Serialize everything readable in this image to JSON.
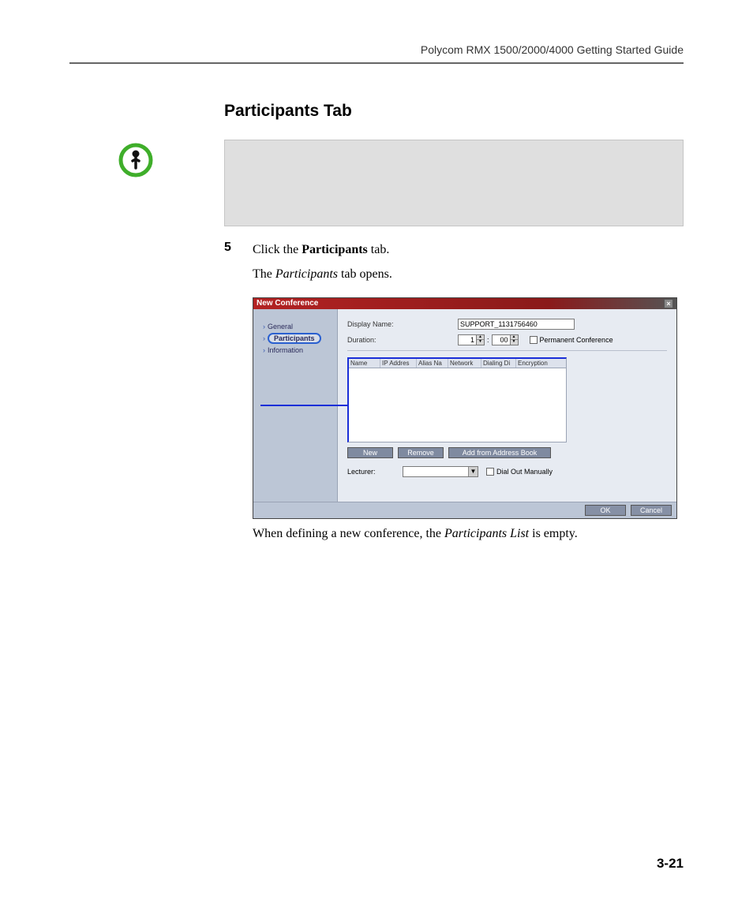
{
  "header": {
    "running": "Polycom RMX 1500/2000/4000 Getting Started Guide"
  },
  "section": {
    "title": "Participants Tab"
  },
  "step": {
    "number": "5",
    "line1_a": "Click the ",
    "line1_b": "Participants",
    "line1_c": " tab.",
    "line2_a": "The ",
    "line2_b": "Participants",
    "line2_c": " tab opens."
  },
  "dialog": {
    "title": "New Conference",
    "close": "×",
    "nav": {
      "general": "General",
      "participants": "Participants",
      "information": "Information"
    },
    "form": {
      "display_name_label": "Display Name:",
      "display_name_value": "SUPPORT_1131756460",
      "duration_label": "Duration:",
      "duration_h": "1",
      "duration_sep": ":",
      "duration_m": "00",
      "permanent_label": "Permanent Conference"
    },
    "columns": {
      "c1": "Name",
      "c2": "IP Addres",
      "c3": "Alias Na",
      "c4": "Network",
      "c5": "Dialing Di",
      "c6": "Encryption"
    },
    "buttons": {
      "new": "New",
      "remove": "Remove",
      "addr": "Add from Address Book"
    },
    "lecturer": {
      "label": "Lecturer:",
      "dial_out": "Dial Out Manually"
    },
    "footer": {
      "ok": "OK",
      "cancel": "Cancel"
    }
  },
  "after": {
    "a": "When defining a new conference, the ",
    "b": "Participants List",
    "c": " is empty."
  },
  "page_number": "3-21"
}
